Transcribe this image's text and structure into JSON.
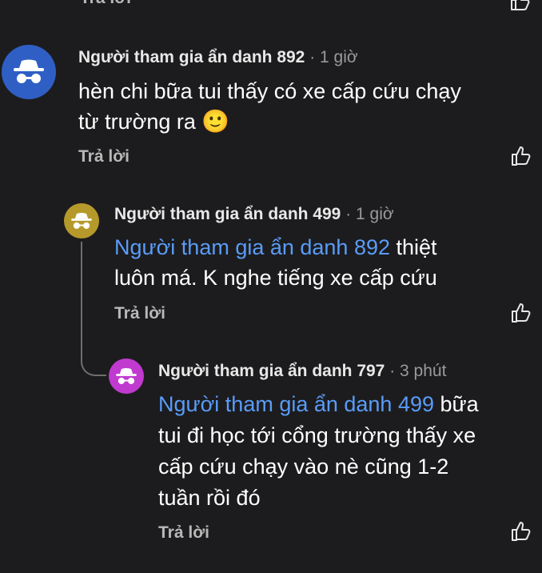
{
  "top": {
    "reply_label": "Trả lời"
  },
  "c1": {
    "author": "Người tham gia ẩn danh 892",
    "time": "· 1 giờ",
    "line1": "hèn chi bữa tui thấy có xe cấp cứu chạy",
    "line2": "từ trường ra",
    "emoji": "🙂",
    "reply_label": "Trả lời",
    "avatar_color": "#2f5fc4"
  },
  "c2": {
    "author": "Người tham gia ẩn danh 499",
    "time": "· 1 giờ",
    "mention": "Người tham gia ẩn danh 892",
    "line1_rest": " thiệt",
    "line2": "luôn má. K nghe tiếng xe cấp cứu",
    "reply_label": "Trả lời",
    "avatar_color": "#b59a2b"
  },
  "c3": {
    "author": "Người tham gia ẩn danh 797",
    "time": "· 3 phút",
    "mention": "Người tham gia ẩn danh 499",
    "line1_rest": " bữa",
    "line2": "tui đi học tới cổng trường thấy xe",
    "line3": "cấp cứu chạy vào nè cũng 1-2",
    "line4": "tuần rồi đó",
    "reply_label": "Trả lời",
    "avatar_color": "#c03ad0"
  }
}
